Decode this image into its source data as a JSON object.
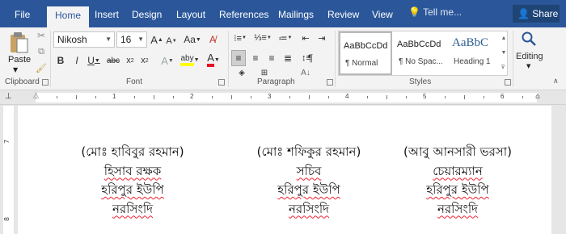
{
  "tabs": [
    "File",
    "Home",
    "Insert",
    "Design",
    "Layout",
    "References",
    "Mailings",
    "Review",
    "View"
  ],
  "active_tab": "Home",
  "tell_me": "Tell me...",
  "share_label": "Share",
  "clipboard": {
    "paste_label": "Paste",
    "group_label": "Clipboard"
  },
  "font": {
    "name": "Nikosh",
    "size": "16",
    "group_label": "Font"
  },
  "paragraph": {
    "group_label": "Paragraph"
  },
  "styles": {
    "group_label": "Styles",
    "items": [
      {
        "sample": "AaBbCcDd",
        "name": "¶ Normal"
      },
      {
        "sample": "AaBbCcDd",
        "name": "¶ No Spac..."
      },
      {
        "sample": "AaBbC",
        "name": "Heading 1"
      }
    ]
  },
  "editing_label": "Editing",
  "ruler_numbers": [
    "1",
    "2",
    "3",
    "4",
    "5",
    "6"
  ],
  "document": {
    "columns": [
      [
        "(মোঃ হাবিবুর রহমান)",
        "হিসাব রক্ষক",
        "হরিপুর ইউপি",
        "নরসিংদি"
      ],
      [
        "(মোঃ শফিকুর রহমান)",
        "সচিব",
        "হরিপুর ইউপি",
        "নরসিংদি"
      ],
      [
        "(আবু আনসারী ভরসা)",
        "চেয়ারম্যান",
        "হরিপুর ইউপি",
        "নরসিংদি"
      ]
    ]
  },
  "colors": {
    "accent": "#2b579a",
    "font_color": "#e81123",
    "highlight": "#ffff00"
  }
}
